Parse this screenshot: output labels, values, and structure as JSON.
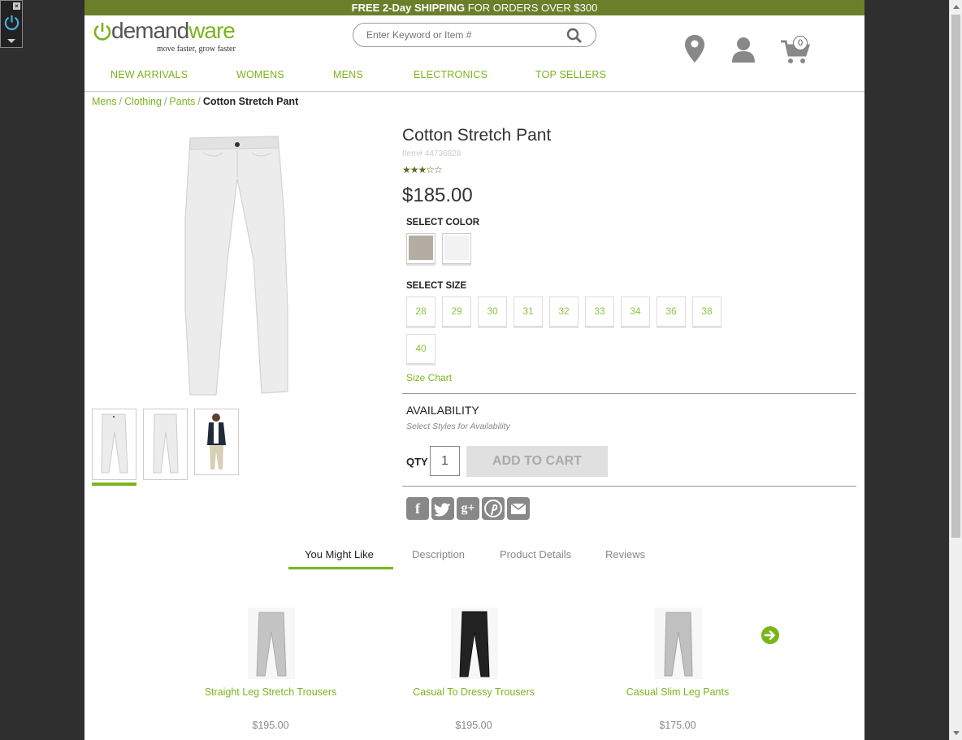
{
  "promo": {
    "bold": "FREE 2-Day SHIPPING",
    "rest": " FOR ORDERS OVER $300"
  },
  "logo": {
    "word_a": "demand",
    "word_b": "ware",
    "tagline": "move faster, grow faster"
  },
  "search": {
    "placeholder": "Enter Keyword or Item #"
  },
  "header_icons": [
    "location-pin-icon",
    "user-icon",
    "cart-icon"
  ],
  "cart": {
    "count": "0"
  },
  "nav": [
    "NEW ARRIVALS",
    "WOMENS",
    "MENS",
    "ELECTRONICS",
    "TOP SELLERS"
  ],
  "breadcrumb": {
    "items": [
      "Mens",
      "Clothing",
      "Pants"
    ],
    "separator": "/",
    "current": "Cotton Stretch Pant"
  },
  "product": {
    "name": "Cotton Stretch Pant",
    "item_number": "Item# 44736828",
    "stars": "★★★☆☆",
    "rating": 3.5,
    "price": "$185.00",
    "select_color_label": "SELECT COLOR",
    "colors": [
      "#b5ada4",
      "#f2f2f2"
    ],
    "select_size_label": "SELECT SIZE",
    "sizes": [
      "28",
      "29",
      "30",
      "31",
      "32",
      "33",
      "34",
      "36",
      "38",
      "40"
    ],
    "size_chart": "Size Chart",
    "availability_title": "AVAILABILITY",
    "availability_sub": "Select Styles for Availability",
    "qty_label": "QTY",
    "qty": "1",
    "add_to_cart": "ADD TO CART"
  },
  "share_icons": [
    "facebook-icon",
    "twitter-icon",
    "google-plus-icon",
    "pinterest-icon",
    "email-icon"
  ],
  "tabs": [
    "You Might Like",
    "Description",
    "Product Details",
    "Reviews"
  ],
  "recommendations": [
    {
      "name": "Straight Leg Stretch Trousers",
      "price": "$195.00"
    },
    {
      "name": "Casual To Dressy Trousers",
      "price": "$195.00"
    },
    {
      "name": "Casual Slim Leg Pants",
      "price": "$175.00"
    }
  ],
  "colors": {
    "brand_green": "#7ab51d",
    "promo_bar": "#6b7f2a",
    "icon_gray": "#888888"
  }
}
